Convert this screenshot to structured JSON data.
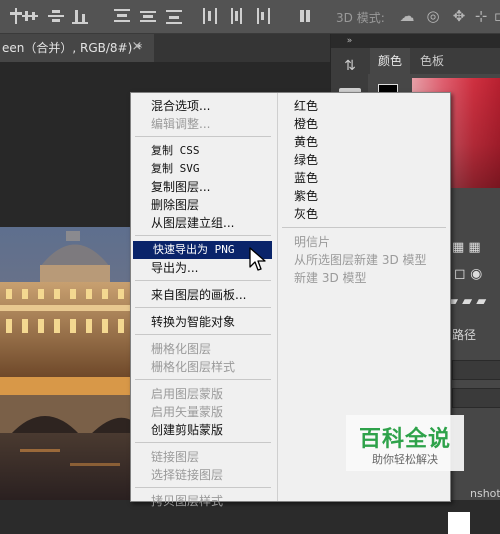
{
  "options_bar": {
    "label_3d": "3D 模式:",
    "icons": [
      "align-top-icon",
      "align-vcenter-icon",
      "align-bottom-icon",
      "align-left-icon",
      "align-hcenter-icon",
      "align-right-icon",
      "distribute-top-icon",
      "distribute-vcenter-icon",
      "distribute-bottom-icon",
      "distribute-left-icon",
      "distribute-hcenter-icon",
      "distribute-right-icon",
      "auto-align-icon",
      "orbit-3d-icon",
      "roll-3d-icon",
      "pan-3d-icon",
      "slide-3d-icon",
      "scale-3d-icon"
    ]
  },
  "document_tab": {
    "title": "een（合并）, RGB/8#) *",
    "close_glyph": "×"
  },
  "panel_strip": {
    "collapse_glyph": "»"
  },
  "right_panel": {
    "tabs": [
      "颜色",
      "色板"
    ],
    "paths_tab": "路径",
    "partial_text": "nshot"
  },
  "context_menu": {
    "left_items": [
      {
        "label": "混合选项...",
        "disabled": false
      },
      {
        "label": "编辑调整...",
        "disabled": true
      },
      {
        "label": "复制 CSS",
        "disabled": false
      },
      {
        "label": "复制 SVG",
        "disabled": false
      },
      {
        "label": "复制图层...",
        "disabled": false
      },
      {
        "label": "删除图层",
        "disabled": false
      },
      {
        "label": "从图层建立组...",
        "disabled": false
      },
      {
        "label": "快速导出为 PNG",
        "disabled": false,
        "highlighted": true
      },
      {
        "label": "导出为...",
        "disabled": false
      },
      {
        "label": "来自图层的画板...",
        "disabled": false
      },
      {
        "label": "转换为智能对象",
        "disabled": false
      },
      {
        "label": "栅格化图层",
        "disabled": true
      },
      {
        "label": "栅格化图层样式",
        "disabled": true
      },
      {
        "label": "启用图层蒙版",
        "disabled": true
      },
      {
        "label": "启用矢量蒙版",
        "disabled": true
      },
      {
        "label": "创建剪贴蒙版",
        "disabled": false
      },
      {
        "label": "链接图层",
        "disabled": true
      },
      {
        "label": "选择链接图层",
        "disabled": true
      },
      {
        "label": "拷贝图层样式",
        "disabled": true
      }
    ],
    "right_items": [
      {
        "label": "红色",
        "disabled": false
      },
      {
        "label": "橙色",
        "disabled": false
      },
      {
        "label": "黄色",
        "disabled": false
      },
      {
        "label": "绿色",
        "disabled": false
      },
      {
        "label": "蓝色",
        "disabled": false
      },
      {
        "label": "紫色",
        "disabled": false
      },
      {
        "label": "灰色",
        "disabled": false
      },
      {
        "label": "明信片",
        "disabled": true
      },
      {
        "label": "从所选图层新建 3D 模型",
        "disabled": true
      },
      {
        "label": "新建 3D 模型",
        "disabled": true
      }
    ]
  },
  "watermark": {
    "title": "百科全说",
    "subtitle": "助你轻松解决"
  },
  "colors": {
    "menu_highlight": "#0a246a",
    "watermark_green": "#2ea24a"
  }
}
